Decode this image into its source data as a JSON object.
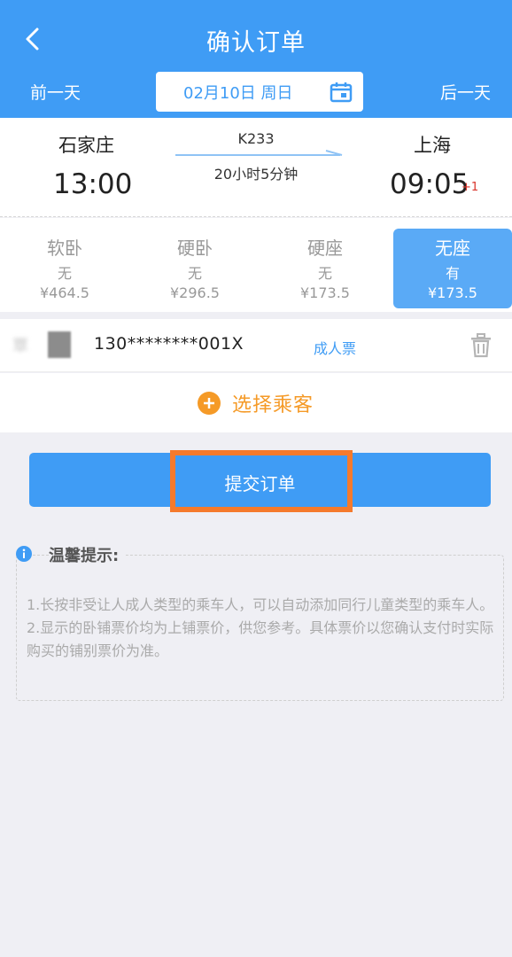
{
  "header": {
    "title": "确认订单",
    "prev_day": "前一天",
    "next_day": "后一天",
    "date": "02月10日 周日"
  },
  "train": {
    "from_station": "石家庄",
    "from_time": "13:00",
    "to_station": "上海",
    "to_time": "09:05",
    "plus_day": "+1",
    "train_no": "K233",
    "duration": "20小时5分钟"
  },
  "seats": [
    {
      "name": "软卧",
      "avail": "无",
      "price": "¥464.5",
      "selected": false
    },
    {
      "name": "硬卧",
      "avail": "无",
      "price": "¥296.5",
      "selected": false
    },
    {
      "name": "硬座",
      "avail": "无",
      "price": "¥173.5",
      "selected": false
    },
    {
      "name": "无座",
      "avail": "有",
      "price": "¥173.5",
      "selected": true
    }
  ],
  "passenger": {
    "name_partial": "覃",
    "id_number": "130********001X",
    "ticket_type": "成人票"
  },
  "add_passenger": "选择乘客",
  "submit_label": "提交订单",
  "tips": {
    "title": "温馨提示:",
    "line1": "1.长按非受让人成人类型的乘车人，可以自动添加同行儿童类型的乘车人。",
    "line2": "2.显示的卧铺票价均为上铺票价，供您参考。具体票价以您确认支付时实际购买的铺别票价为准。"
  },
  "colors": {
    "primary": "#3f9cf5",
    "accent_orange": "#f59a27",
    "highlight_border": "#f57a2c"
  }
}
